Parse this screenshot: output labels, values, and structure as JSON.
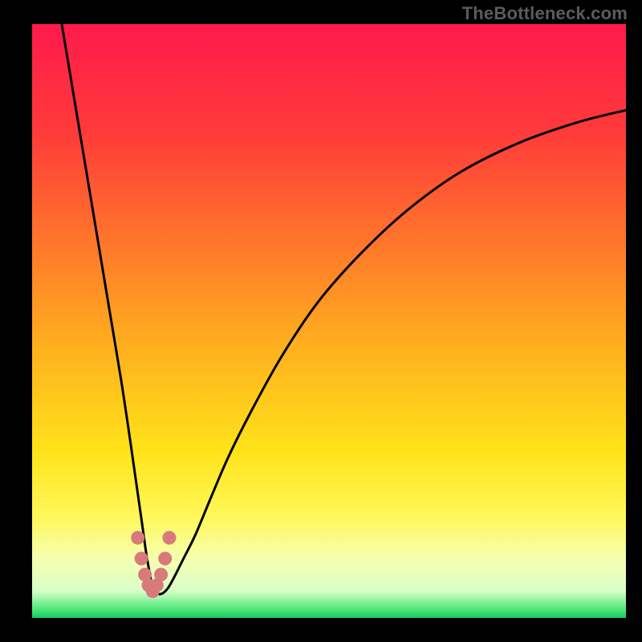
{
  "watermark": "TheBottleneck.com",
  "chart_data": {
    "type": "line",
    "title": "",
    "xlabel": "",
    "ylabel": "",
    "xlim": [
      0,
      100
    ],
    "ylim": [
      0,
      100
    ],
    "gradient_stops": [
      {
        "pos": 0.0,
        "color": "#ff1a4d"
      },
      {
        "pos": 0.18,
        "color": "#ff3a3a"
      },
      {
        "pos": 0.38,
        "color": "#ff7a2a"
      },
      {
        "pos": 0.55,
        "color": "#ffb21e"
      },
      {
        "pos": 0.72,
        "color": "#ffe31a"
      },
      {
        "pos": 0.83,
        "color": "#fff85a"
      },
      {
        "pos": 0.9,
        "color": "#f6ffb0"
      },
      {
        "pos": 0.955,
        "color": "#d8ffc8"
      },
      {
        "pos": 0.985,
        "color": "#4fe87a"
      },
      {
        "pos": 1.0,
        "color": "#18c95e"
      }
    ],
    "series": [
      {
        "name": "bottleneck-curve",
        "color": "#000000",
        "x": [
          5,
          7,
          9,
          11,
          13,
          15,
          16.5,
          17.5,
          18.5,
          19.2,
          19.8,
          20.3,
          20.8,
          21.5,
          22.2,
          23,
          24,
          25.5,
          27.5,
          30,
          33,
          37,
          42,
          48,
          55,
          63,
          72,
          82,
          92,
          100
        ],
        "y": [
          100,
          88,
          76,
          64,
          52,
          40,
          30,
          23,
          16,
          11,
          7.5,
          5.2,
          4.3,
          4.0,
          4.3,
          5.2,
          7.0,
          10,
          14,
          20,
          27,
          35,
          44,
          53,
          61,
          68.5,
          75,
          80,
          83.5,
          85.5
        ]
      },
      {
        "name": "marker-band",
        "color": "#d87a7a",
        "x": [
          17.8,
          18.4,
          19.0,
          19.6,
          20.3,
          21.0,
          21.7,
          22.4,
          23.1
        ],
        "y": [
          13.5,
          10.0,
          7.3,
          5.5,
          4.5,
          5.5,
          7.3,
          10.0,
          13.5
        ]
      }
    ]
  }
}
